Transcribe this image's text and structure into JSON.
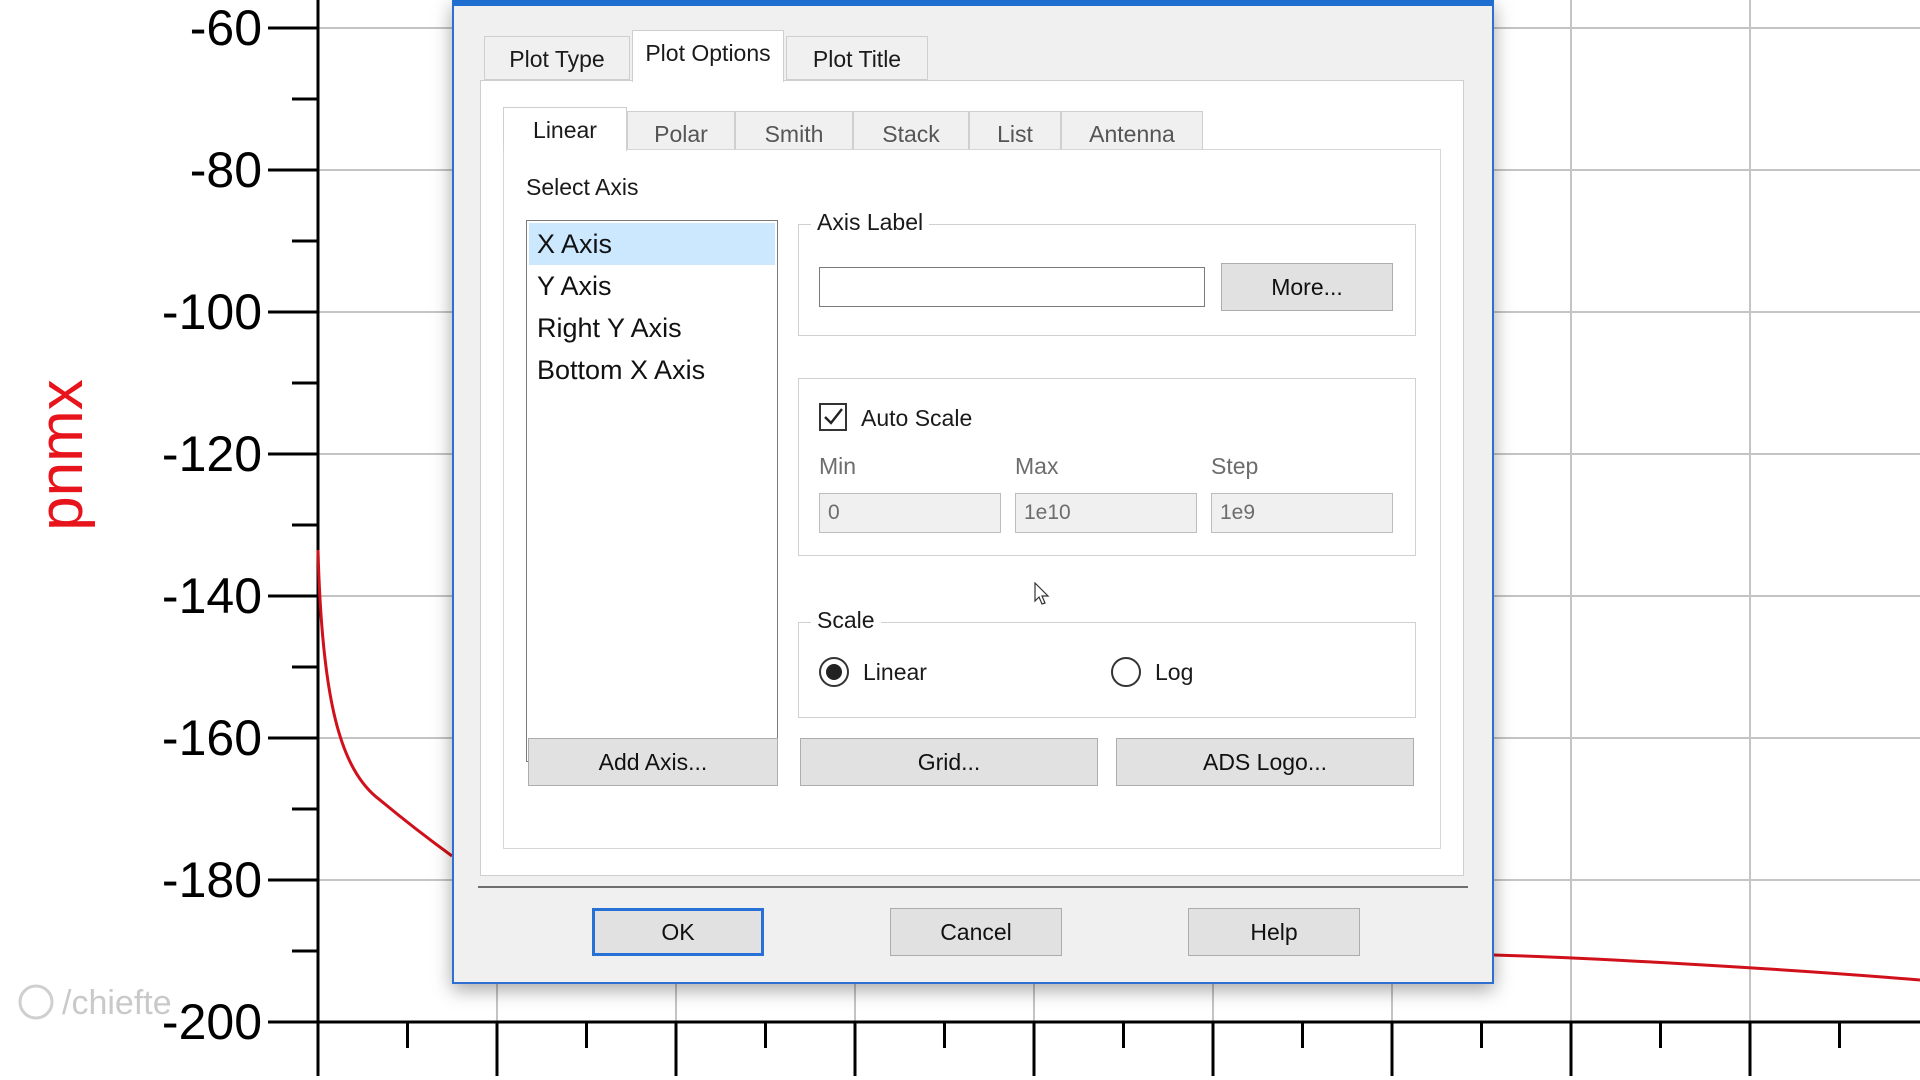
{
  "background_plot": {
    "y_ticks": [
      "-60",
      "-80",
      "-100",
      "-120",
      "-140",
      "-160",
      "-180",
      "-200"
    ],
    "y_label": "pnmx",
    "trace_color": "#d0101a",
    "watermark": "/chiefte"
  },
  "dialog": {
    "top_tabs": [
      {
        "label": "Plot Type",
        "active": false
      },
      {
        "label": "Plot Options",
        "active": true
      },
      {
        "label": "Plot Title",
        "active": false
      }
    ],
    "sub_tabs": [
      {
        "label": "Linear",
        "active": true
      },
      {
        "label": "Polar",
        "active": false
      },
      {
        "label": "Smith",
        "active": false
      },
      {
        "label": "Stack",
        "active": false
      },
      {
        "label": "List",
        "active": false
      },
      {
        "label": "Antenna",
        "active": false
      }
    ],
    "select_axis_label": "Select Axis",
    "axis_list": [
      {
        "label": "X Axis",
        "selected": true
      },
      {
        "label": "Y Axis",
        "selected": false
      },
      {
        "label": "Right Y Axis",
        "selected": false
      },
      {
        "label": "Bottom X Axis",
        "selected": false
      }
    ],
    "axis_label_group": {
      "title": "Axis Label",
      "value": "",
      "more_button": "More..."
    },
    "auto_scale": {
      "label": "Auto Scale",
      "checked": true,
      "min_label": "Min",
      "max_label": "Max",
      "step_label": "Step",
      "min_value": "0",
      "max_value": "1e10",
      "step_value": "1e9"
    },
    "scale_group": {
      "title": "Scale",
      "linear_label": "Linear",
      "log_label": "Log",
      "selected": "Linear"
    },
    "buttons": {
      "add_axis": "Add Axis...",
      "grid": "Grid...",
      "ads_logo": "ADS Logo...",
      "ok": "OK",
      "cancel": "Cancel",
      "help": "Help"
    },
    "accent_color": "#2770d6",
    "selection_color": "#cce8ff"
  }
}
